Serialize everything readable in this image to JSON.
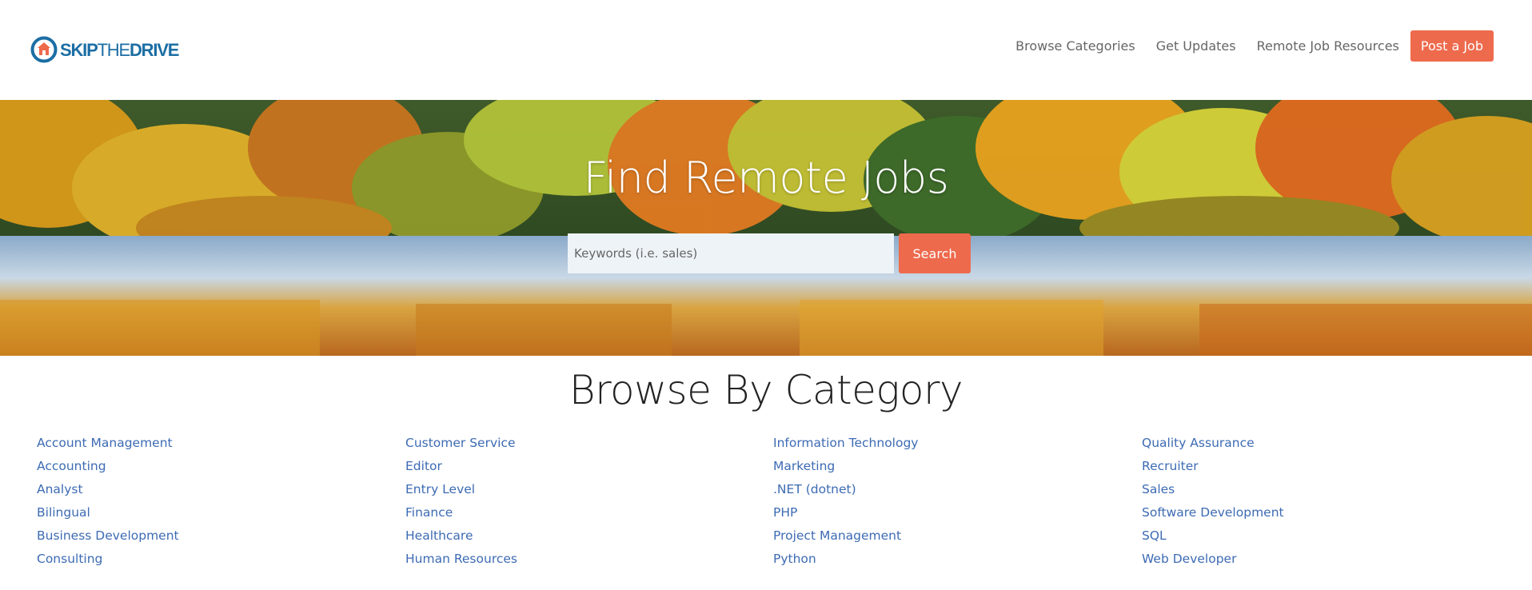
{
  "header": {
    "logo": {
      "text_bold": "SKIP",
      "text_thin": "THE",
      "text_bold2": "DRIVE",
      "icon": "house-pin-logo-icon"
    },
    "nav": {
      "browse_categories": "Browse Categories",
      "get_updates": "Get Updates",
      "remote_job_resources": "Remote Job Resources",
      "post_a_job": "Post a Job"
    }
  },
  "hero": {
    "title": "Find Remote Jobs",
    "search": {
      "placeholder": "Keywords (i.e. sales)",
      "value": "",
      "button_label": "Search"
    }
  },
  "categories": {
    "title": "Browse By Category",
    "columns": [
      [
        "Account Management",
        "Accounting",
        "Analyst",
        "Bilingual",
        "Business Development",
        "Consulting"
      ],
      [
        "Customer Service",
        "Editor",
        "Entry Level",
        "Finance",
        "Healthcare",
        "Human Resources"
      ],
      [
        "Information Technology",
        "Marketing",
        ".NET (dotnet)",
        "PHP",
        "Project Management",
        "Python"
      ],
      [
        "Quality Assurance",
        "Recruiter",
        "Sales",
        "Software Development",
        "SQL",
        "Web Developer"
      ]
    ]
  },
  "colors": {
    "accent": "#ee6a4d",
    "link": "#3d6bb3",
    "brand": "#1c6ea4"
  }
}
